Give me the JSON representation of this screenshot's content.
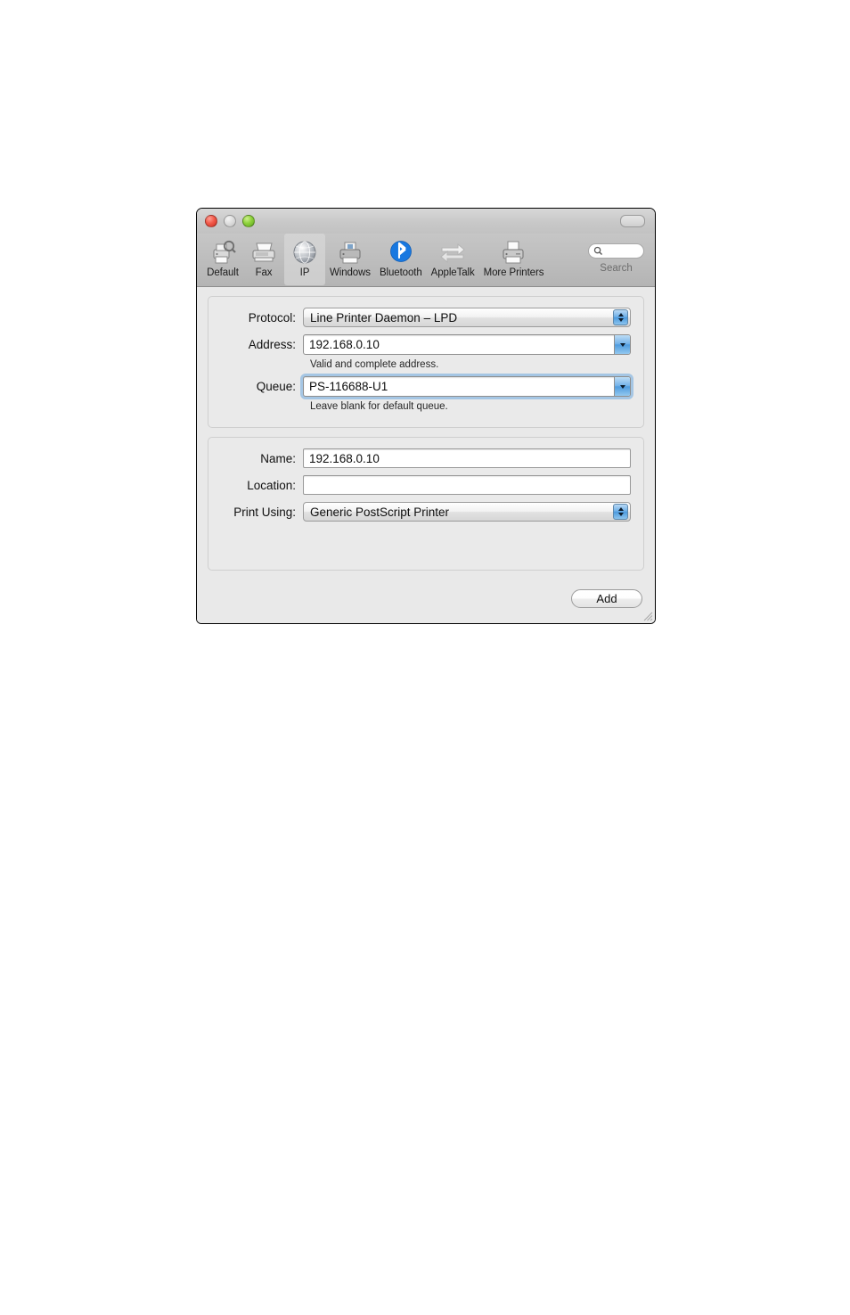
{
  "window": {
    "traffic_lights": [
      "close",
      "minimize",
      "zoom"
    ],
    "toolbar_toggle": "toolbar-toggle-pill"
  },
  "toolbar": {
    "items": [
      {
        "label": "Default",
        "icon": "printer-magnifier-icon",
        "selected": false
      },
      {
        "label": "Fax",
        "icon": "fax-machine-icon",
        "selected": false
      },
      {
        "label": "IP",
        "icon": "globe-icon",
        "selected": true
      },
      {
        "label": "Windows",
        "icon": "windows-printer-icon",
        "selected": false
      },
      {
        "label": "Bluetooth",
        "icon": "bluetooth-icon",
        "selected": false
      },
      {
        "label": "AppleTalk",
        "icon": "two-arrows-icon",
        "selected": false
      },
      {
        "label": "More Printers",
        "icon": "printer-icon",
        "selected": false
      }
    ],
    "search": {
      "icon": "search-icon",
      "label": "Search",
      "value": "",
      "placeholder": ""
    }
  },
  "connection_panel": {
    "protocol": {
      "label": "Protocol:",
      "value": "Line Printer Daemon – LPD",
      "control": "popup-button"
    },
    "address": {
      "label": "Address:",
      "value": "192.168.0.10",
      "placeholder": "",
      "control": "combo-box",
      "hint": "Valid and complete address."
    },
    "queue": {
      "label": "Queue:",
      "value": "PS-116688-U1",
      "placeholder": "",
      "control": "combo-box",
      "focused": true,
      "hint": "Leave blank for default queue."
    }
  },
  "details_panel": {
    "name": {
      "label": "Name:",
      "value": "192.168.0.10",
      "placeholder": ""
    },
    "location": {
      "label": "Location:",
      "value": "",
      "placeholder": ""
    },
    "print_using": {
      "label": "Print Using:",
      "value": "Generic PostScript Printer",
      "control": "popup-button"
    }
  },
  "footer": {
    "add_label": "Add"
  },
  "colors": {
    "accent_blue": "#4f9cdf",
    "focus_ring": "#6ca7de",
    "bluetooth_blue": "#1878e0",
    "window_bg": "#e9e9e9",
    "toolbar_bg": "#bfbfbf"
  }
}
